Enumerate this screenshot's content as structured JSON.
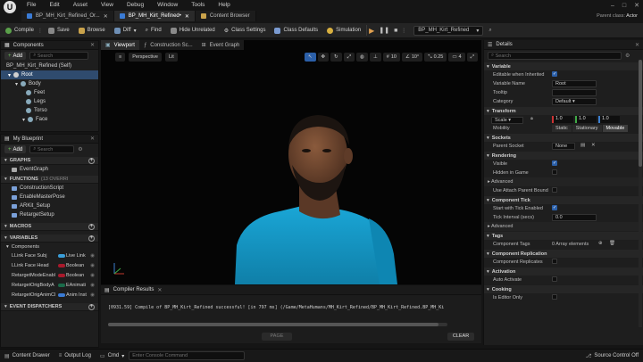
{
  "menu": [
    "File",
    "Edit",
    "Asset",
    "View",
    "Debug",
    "Window",
    "Tools",
    "Help"
  ],
  "title_right": {
    "parent_class_label": "Parent class:",
    "parent_class_value": "Actor"
  },
  "doc_tabs": [
    {
      "label": "BP_MH_Kirt_Refined_Or..."
    },
    {
      "label": "BP_MH_Kirt_Refined•"
    },
    {
      "label": "Content Browser"
    }
  ],
  "toolbar": {
    "compile": "Compile",
    "save": "Save",
    "browse": "Browse",
    "diff": "Diff",
    "find": "Find",
    "hide_unrelated": "Hide Unrelated",
    "class_settings": "Class Settings",
    "class_defaults": "Class Defaults",
    "simulation": "Simulation",
    "debug_object": "BP_MH_Kirt_Refined"
  },
  "components": {
    "title": "Components",
    "add": "Add",
    "search_placeholder": "Search",
    "items": [
      {
        "label": "BP_MH_Kirt_Refined (Self)"
      },
      {
        "label": "Root"
      },
      {
        "label": "Body"
      },
      {
        "label": "Feet"
      },
      {
        "label": "Legs"
      },
      {
        "label": "Torso"
      },
      {
        "label": "Face"
      }
    ]
  },
  "blueprint": {
    "title": "My Blueprint",
    "add": "Add",
    "search_placeholder": "Search",
    "graphs_label": "GRAPHS",
    "event_graph": "EventGraph",
    "functions_label": "FUNCTIONS",
    "functions_count": "(13 OVERRI",
    "functions": [
      "ConstructionScript",
      "EnableMasterPose",
      "ARKit_Setup",
      "RetargetSetup"
    ],
    "macros_label": "MACROS",
    "variables_label": "VARIABLES",
    "components_label": "Components",
    "variables": [
      {
        "name": "LLink Face Subj",
        "type": "Live Link",
        "color": "#3a9ed8"
      },
      {
        "name": "LLink Face Head",
        "type": "Boolean",
        "color": "#a8192b"
      },
      {
        "name": "RetargetModeEnabl",
        "type": "Boolean",
        "color": "#a8192b"
      },
      {
        "name": "RetargetOrigBodyA",
        "type": "EAnimati",
        "color": "#1a6b4a"
      },
      {
        "name": "RetargetOrigAnimCl",
        "type": "Anim Inst",
        "color": "#3a7bd5"
      }
    ],
    "dispatchers_label": "EVENT DISPATCHERS"
  },
  "viewport_tabs": [
    {
      "label": "Viewport"
    },
    {
      "label": "Construction Sc..."
    },
    {
      "label": "Event Graph"
    }
  ],
  "viewport": {
    "perspective": "Perspective",
    "lit": "Lit",
    "grid_snap": "10",
    "rot_snap": "10°",
    "scale_snap": "0.25",
    "cam_speed": "4"
  },
  "compiler": {
    "title": "Compiler Results",
    "log": "[0931.59] Compile of BP_MH_Kirt_Refined successful! [in 797 ms] (/Game/MetaHumans/MH_Kirt_Refined/BP_MH_Kirt_Refined.BP_MH_Ki",
    "page": "PAGE",
    "clear": "CLEAR"
  },
  "details": {
    "title": "Details",
    "search_placeholder": "Search",
    "sections": {
      "variable": "Variable",
      "transform": "Transform",
      "sockets": "Sockets",
      "rendering": "Rendering",
      "advanced": "Advanced",
      "component_tick": "Component Tick",
      "advanced2": "Advanced",
      "tags": "Tags",
      "replication": "Component Replication",
      "activation": "Activation",
      "cooking": "Cooking"
    },
    "rows": {
      "editable": "Editable when Inherited",
      "var_name_label": "Variable Name",
      "var_name_value": "Root",
      "tooltip": "Tooltip",
      "category_label": "Category",
      "category_value": "Default",
      "scale_label": "Scale",
      "scale_x": "1.0",
      "scale_y": "1.0",
      "scale_z": "1.0",
      "mobility_label": "Mobility",
      "mob_static": "Static",
      "mob_stationary": "Stationary",
      "mob_movable": "Movable",
      "parent_socket_label": "Parent Socket",
      "parent_socket_value": "None",
      "visible": "Visible",
      "hidden_in_game": "Hidden in Game",
      "use_attach": "Use Attach Parent Bound",
      "start_tick": "Start with Tick Enabled",
      "tick_interval_label": "Tick Interval (secs)",
      "tick_interval_value": "0.0",
      "component_tags_label": "Component Tags",
      "component_tags_value": "0 Array elements",
      "component_replicates": "Component Replicates",
      "auto_activate": "Auto Activate",
      "is_editor_only": "Is Editor Only"
    }
  },
  "statusbar": {
    "content_drawer": "Content Drawer",
    "output_log": "Output Log",
    "cmd": "Cmd",
    "console_placeholder": "Enter Console Command",
    "source_control": "Source Control Off"
  }
}
